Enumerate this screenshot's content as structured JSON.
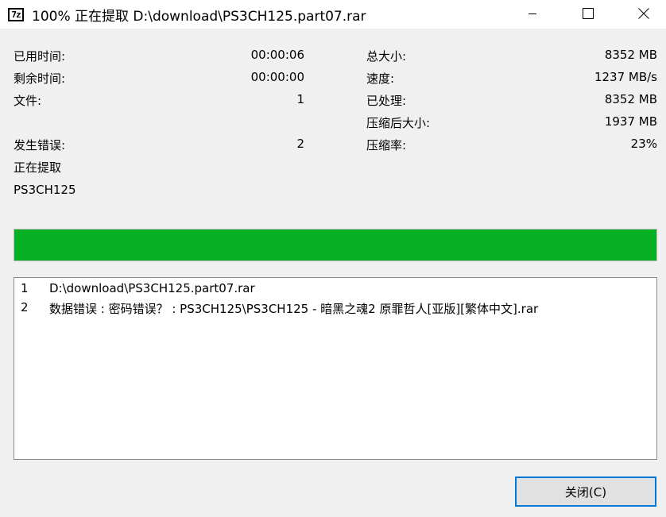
{
  "window": {
    "icon_text": "7z",
    "title": "100% 正在提取 D:\\download\\PS3CH125.part07.rar",
    "minimize_icon": "minimize-icon",
    "maximize_icon": "maximize-icon",
    "close_icon": "close-icon"
  },
  "stats_left": {
    "elapsed_label": "已用时间:",
    "elapsed_value": "00:00:06",
    "remaining_label": "剩余时间:",
    "remaining_value": "00:00:00",
    "files_label": "文件:",
    "files_value": "1",
    "errors_label": "发生错误:",
    "errors_value": "2"
  },
  "stats_right": {
    "total_label": "总大小:",
    "total_value": "8352 MB",
    "speed_label": "速度:",
    "speed_value": "1237 MB/s",
    "processed_label": "已处理:",
    "processed_value": "8352 MB",
    "compressed_label": "压缩后大小:",
    "compressed_value": "1937 MB",
    "ratio_label": "压缩率:",
    "ratio_value": "23%"
  },
  "status": {
    "operation": "正在提取",
    "current_item": "PS3CH125"
  },
  "progress": {
    "percent": 100,
    "color": "#06b025"
  },
  "log": [
    {
      "num": "1",
      "message": "D:\\download\\PS3CH125.part07.rar"
    },
    {
      "num": "2",
      "message": "数据错误 : 密码错误？ : PS3CH125\\PS3CH125 - 暗黑之魂2 原罪哲人[亚版][繁体中文].rar"
    }
  ],
  "buttons": {
    "close_label": "关闭(C)"
  }
}
